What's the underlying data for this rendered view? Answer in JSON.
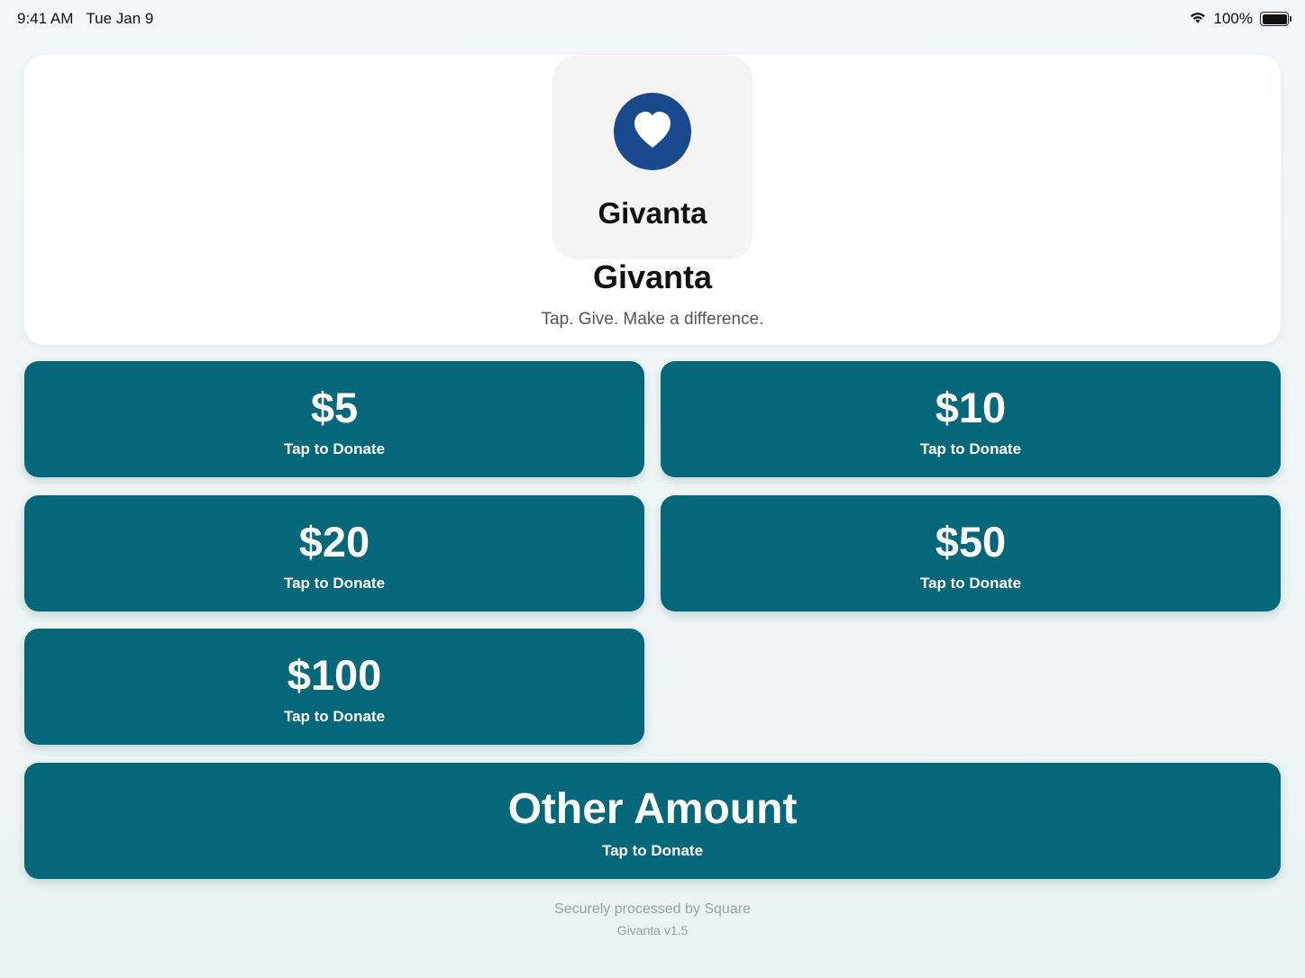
{
  "status_bar": {
    "time": "9:41 AM",
    "date": "Tue Jan 9",
    "battery": "100%",
    "icons": [
      "wifi-icon",
      "battery-icon"
    ]
  },
  "header": {
    "logo_icon": "heart-icon",
    "logo_color": "#1a4a8d",
    "logo_name": "Givanta",
    "title": "Givanta",
    "tagline": "Tap. Give. Make a difference."
  },
  "donations": [
    {
      "amount": "$5",
      "label": "Tap to Donate"
    },
    {
      "amount": "$10",
      "label": "Tap to Donate"
    },
    {
      "amount": "$20",
      "label": "Tap to Donate"
    },
    {
      "amount": "$50",
      "label": "Tap to Donate"
    },
    {
      "amount": "$100",
      "label": "Tap to Donate"
    }
  ],
  "other": {
    "amount": "Other Amount",
    "label": "Tap to Donate"
  },
  "footer": {
    "processor": "Securely processed by Square",
    "version": "Givanta v1.5"
  },
  "colors": {
    "button": "#05677a",
    "background": "#eef5f6"
  }
}
